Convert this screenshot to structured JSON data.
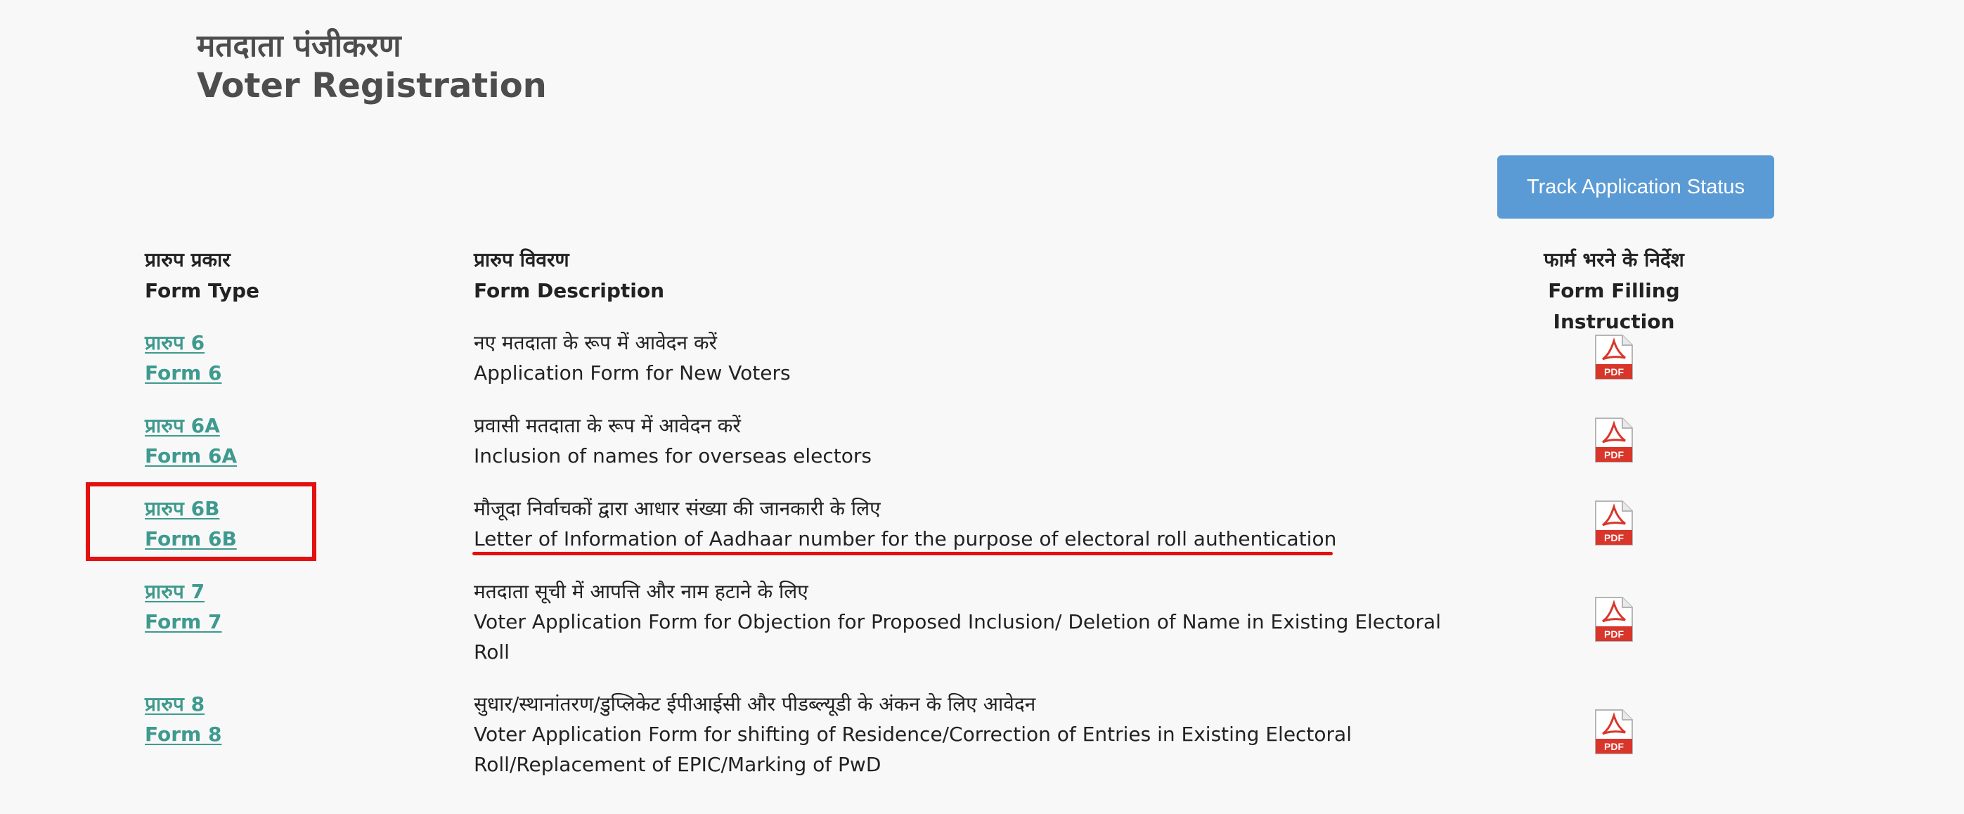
{
  "page": {
    "title_hi": "मतदाता पंजीकरण",
    "title_en": "Voter Registration"
  },
  "track_button": {
    "label": "Track Application Status"
  },
  "headers": {
    "type_hi": "प्रारुप प्रकार",
    "type_en": "Form Type",
    "desc_hi": "प्रारुप विवरण",
    "desc_en": "Form Description",
    "instr_hi": "फार्म भरने के निर्देश",
    "instr_en": "Form Filling Instruction"
  },
  "forms": [
    {
      "name_hi": "प्रारुप 6",
      "name_en": "Form 6",
      "desc_hi": "नए मतदाता के रूप में आवेदन करें",
      "desc_en": "Application Form for New Voters",
      "icon": "pdf-icon"
    },
    {
      "name_hi": "प्रारुप 6A",
      "name_en": "Form 6A",
      "desc_hi": "प्रवासी मतदाता के रूप में आवेदन करें",
      "desc_en": "Inclusion of names for overseas electors",
      "icon": "pdf-icon"
    },
    {
      "name_hi": "प्रारुप 6B",
      "name_en": "Form 6B",
      "desc_hi": "मौजूदा निर्वाचकों द्वारा आधार संख्या की जानकारी के लिए",
      "desc_en": "Letter of Information of Aadhaar number for the purpose of electoral roll authentication",
      "icon": "pdf-icon"
    },
    {
      "name_hi": "प्रारुप 7",
      "name_en": "Form 7",
      "desc_hi": "मतदाता सूची में आपत्ति और नाम हटाने के लिए",
      "desc_en": "Voter Application Form for Objection for Proposed Inclusion/ Deletion of Name in Existing Electoral Roll",
      "icon": "pdf-icon"
    },
    {
      "name_hi": "प्रारुप 8",
      "name_en": "Form 8",
      "desc_hi": "सुधार/स्थानांतरण/डुप्लिकेट ईपीआईसी और पीडब्ल्यूडी के अंकन के लिए आवेदन",
      "desc_en": "Voter Application Form for shifting of Residence/Correction of Entries in Existing Electoral Roll/Replacement of EPIC/Marking of PwD",
      "icon": "pdf-icon"
    }
  ],
  "pdf_label": "PDF",
  "colors": {
    "link": "#3e9a8e",
    "button": "#5b9bd5",
    "highlight": "#e31010",
    "pdf_red": "#d9362b"
  }
}
